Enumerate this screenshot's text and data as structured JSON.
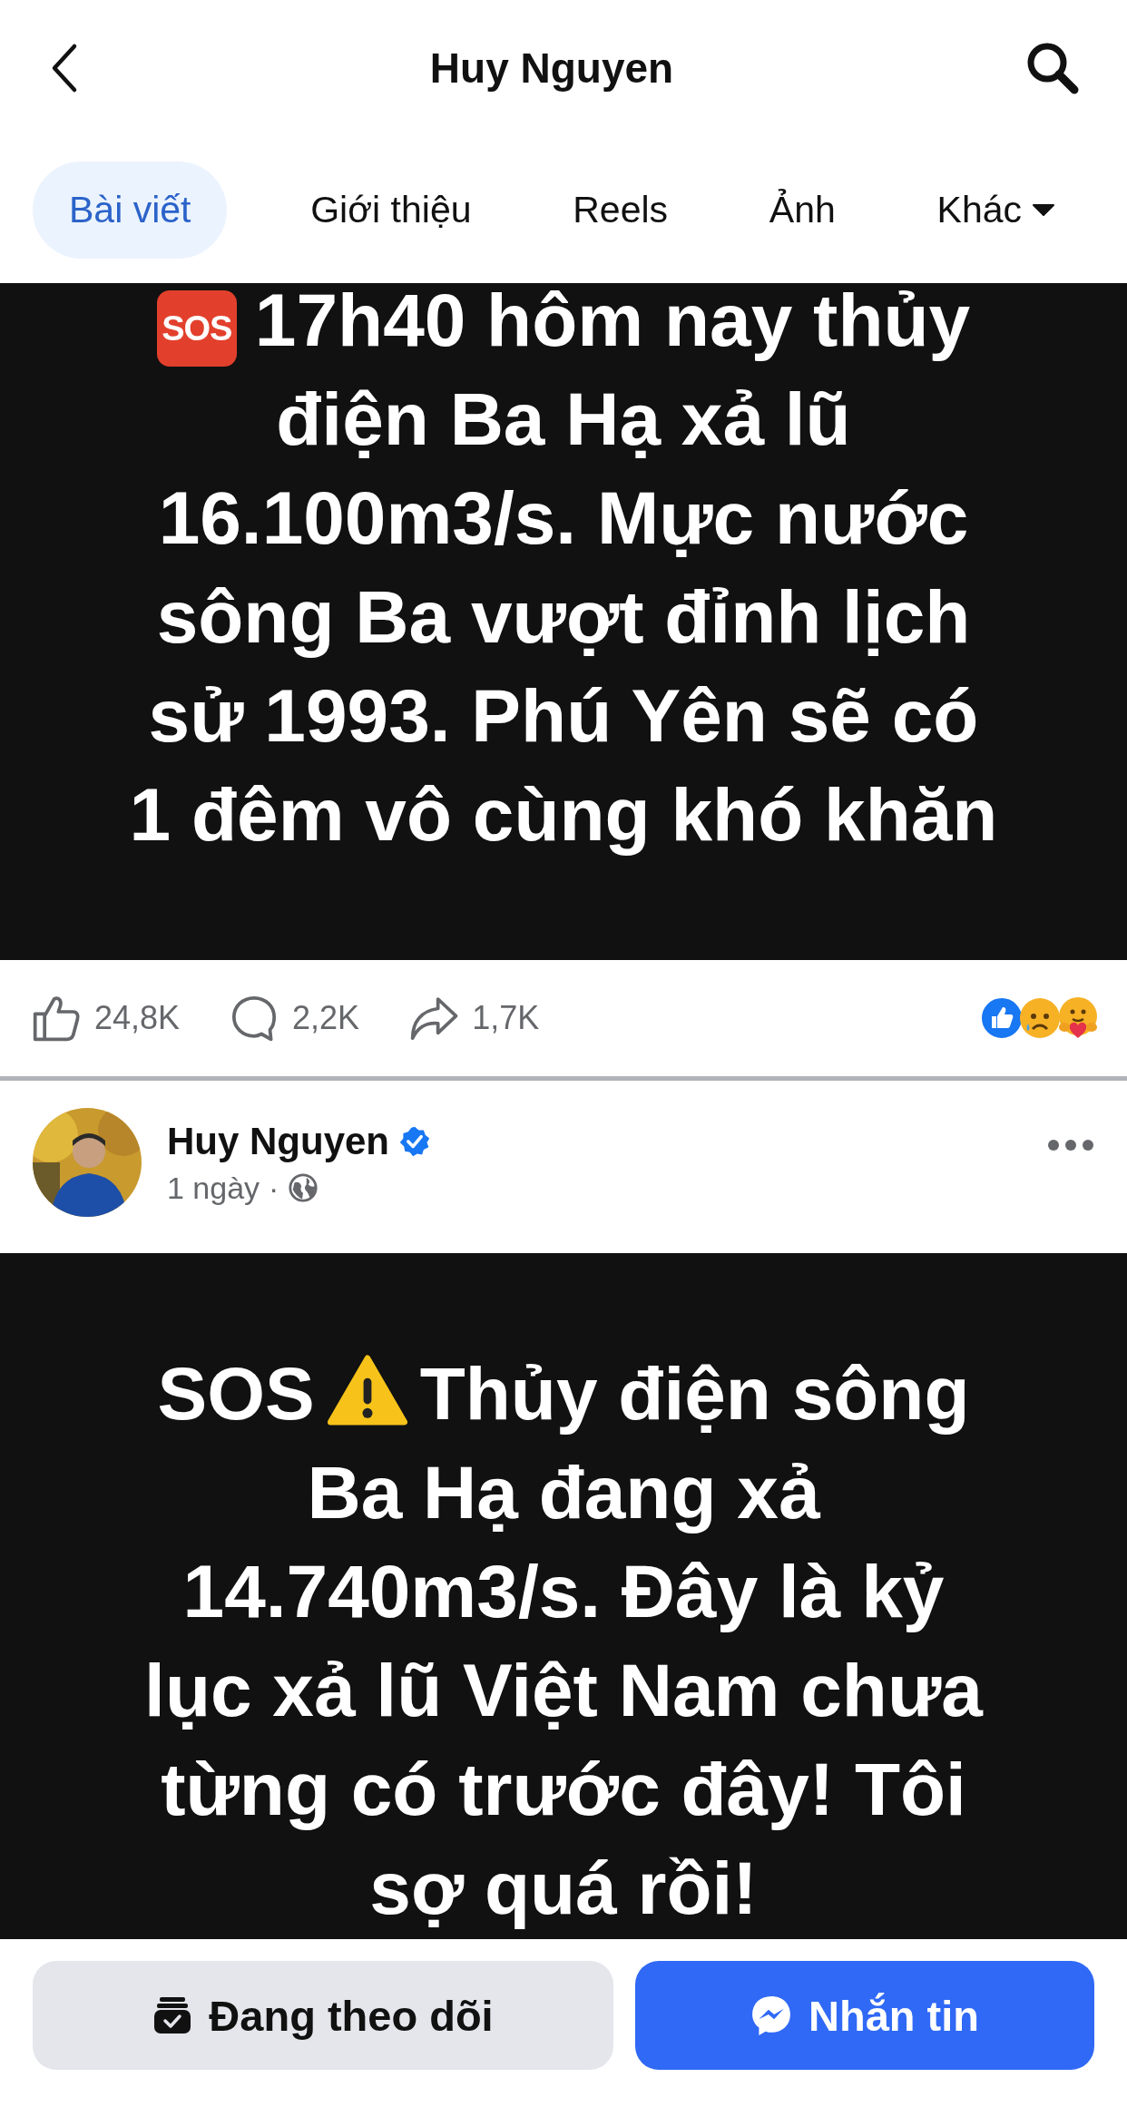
{
  "header": {
    "title": "Huy Nguyen"
  },
  "tabs": [
    {
      "label": "Bài viết",
      "selected": true,
      "kind": "tab"
    },
    {
      "label": "Giới thiệu",
      "selected": false,
      "kind": "tab"
    },
    {
      "label": "Reels",
      "selected": false,
      "kind": "tab"
    },
    {
      "label": "Ảnh",
      "selected": false,
      "kind": "tab"
    },
    {
      "label": "Khác",
      "selected": false,
      "kind": "dropdown"
    }
  ],
  "posts": [
    {
      "prefix": {
        "kind": "emoji_badge",
        "text": "SOS"
      },
      "lines": [
        "17h40 hôm nay thủy",
        "điện Ba Hạ xả lũ",
        "16.100m3/s. Mực nước",
        "sông Ba vượt đỉnh lịch",
        "sử 1993. Phú Yên sẽ có",
        "1 đêm vô cùng khó khăn"
      ],
      "stats": {
        "likes": "24,8K",
        "comments": "2,2K",
        "shares": "1,7K"
      }
    },
    {
      "author": {
        "name": "Huy Nguyen",
        "verified": true,
        "time": "1 ngày",
        "separator": "·"
      },
      "prefix": {
        "kind": "word",
        "text": "SOS"
      },
      "warning": true,
      "lines": [
        "Thủy điện sông",
        "Ba Hạ đang xả",
        "14.740m3/s. Đây là kỷ",
        "lục xả lũ Việt Nam chưa",
        "từng có trước đây! Tôi",
        "sợ quá rồi!"
      ]
    }
  ],
  "actions": [
    {
      "label": "Đang theo dõi",
      "kind": "secondary"
    },
    {
      "label": "Nhắn tin",
      "kind": "primary"
    }
  ]
}
